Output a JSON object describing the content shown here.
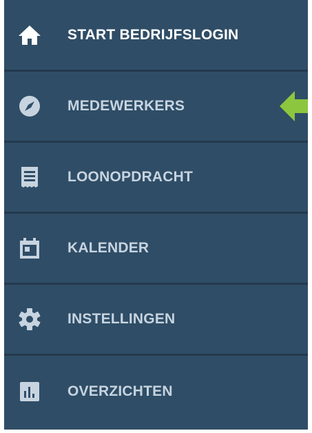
{
  "accent_color": "#8cc63f",
  "sidebar": {
    "items": [
      {
        "label": "START BEDRIJFSLOGIN",
        "icon": "home-icon"
      },
      {
        "label": "MEDEWERKERS",
        "icon": "compass-icon"
      },
      {
        "label": "LOONOPDRACHT",
        "icon": "receipt-icon"
      },
      {
        "label": "KALENDER",
        "icon": "calendar-icon"
      },
      {
        "label": "INSTELLINGEN",
        "icon": "gear-icon"
      },
      {
        "label": "OVERZICHTEN",
        "icon": "bar-chart-icon"
      }
    ]
  }
}
